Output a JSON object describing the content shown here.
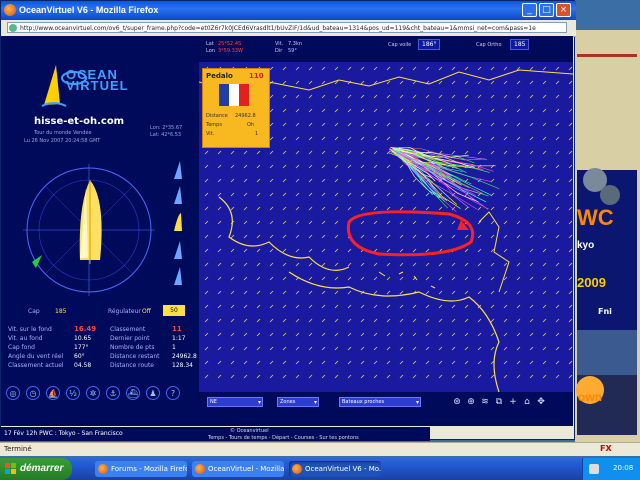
{
  "window": {
    "title": "OceanVirtuel V6 - Mozilla Firefox",
    "url": "http://www.oceanvirtuel.com/ov6_t/super_frame.php?code=et0Z6r7k0JCEd6Vrasdlt1/bUvZiF/1d&ud_bateau=1314&pos_ud=119&cht_bateau=1&mmsi_net=com&pass=1e",
    "status": "Terminé",
    "status_icon": "FX"
  },
  "panel": {
    "logo_line1": "OCEAN",
    "logo_line2": "VIRTUEL",
    "boat_name": "hisse-et-oh.com",
    "race": "Tour du monde Vendée",
    "date": "Lu 26 Nov 2007 20:24:58 GMT",
    "lon": "Lon: 2*35.67",
    "lat": "Lat: 42*6.53",
    "cap_label": "Cap",
    "cap_value": "185",
    "regulateur_label": "Régulateur",
    "regulateur_value": "Off",
    "regulateur_num": "50",
    "stats": [
      {
        "label": "Vit. sur le fond",
        "value": "16.49",
        "red": true
      },
      {
        "label": "Vit. au fond",
        "value": "10.65",
        "red": false
      },
      {
        "label": "Cap fond",
        "value": "177°",
        "red": false
      },
      {
        "label": "Angle du vent réel",
        "value": "60°",
        "red": false
      },
      {
        "label": "Classement actuel",
        "value": "04.58",
        "red": false
      }
    ],
    "stats_right": [
      {
        "label": "Classement",
        "value": "11",
        "red": true
      },
      {
        "label": "Dernier point",
        "value": "1:17",
        "red": false
      },
      {
        "label": "Nombre de pts",
        "value": "1",
        "red": false
      },
      {
        "label": "Distance restant",
        "value": "24962.8",
        "red": false
      },
      {
        "label": "Distance route",
        "value": "128.34",
        "red": false
      }
    ]
  },
  "header": {
    "a_label": "Lat",
    "a_value": "25*52.4S",
    "b_label": "Lon",
    "b_value": "3*59.33W",
    "c_label": "Vit.",
    "c_value": "7.3kn",
    "d_label": "Dir",
    "d_value": "59°",
    "cap_label": "Cap voile",
    "cap_value": "186°",
    "cap2_label": "Cap Ortho",
    "cap2_value": "185"
  },
  "popup": {
    "name": "Pedalo",
    "rank": "110",
    "dist_label": "Distance",
    "dist_value": "24962.8",
    "time_label": "Temps",
    "time_value": "Oh",
    "vit_label": "Vit.",
    "vit_value": "1"
  },
  "flag": {
    "colors": [
      "#1f3ea8",
      "#ffffff",
      "#e32020"
    ]
  },
  "controls": {
    "select1": "NE",
    "select2": "Zones",
    "select3": "Bateaux proches",
    "tools": [
      "compass-tool",
      "zoom-tool",
      "wind-tool",
      "map-tool",
      "cross-tool",
      "home-tool",
      "expand-tool"
    ]
  },
  "ticker": {
    "left": "17 Fév 12h  PWC : Tokyo - San Francisco",
    "mid": "© Oceanvirtuel",
    "mid2": "Temps - Tours de temps - Départ - Courses - Sur tes pontons"
  },
  "ads": {
    "wvc": "WC",
    "kyo": "kyo",
    "year": "2009",
    "fni": "Fni",
    "own": "own"
  },
  "taskbar": {
    "start": "démarrer",
    "tasks": [
      "Forums - Mozilla Firefox",
      "OceanVirtuel - Mozilla...",
      "OceanVirtuel V6 - Mo..."
    ],
    "clock": "20:08"
  },
  "colors": {
    "map_bg": "#1a1aa0",
    "coast": "#ffe040",
    "panel_bg": "#000a5a",
    "highlight": "#ff3030"
  }
}
